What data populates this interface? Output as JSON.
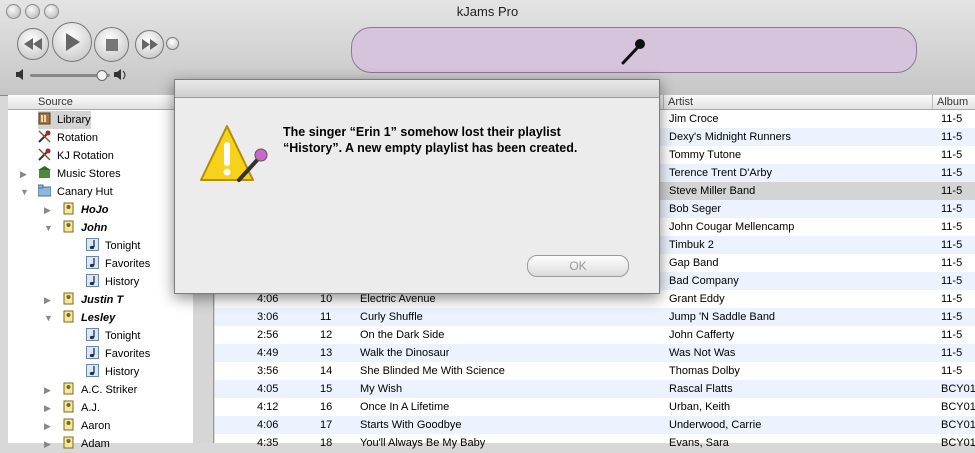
{
  "window": {
    "title": "kJams Pro"
  },
  "transport": {
    "rewind_icon": "rewind-icon",
    "play_icon": "play-icon",
    "stop_icon": "stop-icon",
    "forward_icon": "fast-forward-icon"
  },
  "source": {
    "header": "Source",
    "items": [
      {
        "label": "Library",
        "icon": "library-icon",
        "indent": 0,
        "bold": false,
        "italic": false,
        "disclosure": "",
        "selected": true
      },
      {
        "label": "Rotation",
        "icon": "mic-rotation-icon",
        "indent": 0,
        "bold": false,
        "italic": false,
        "disclosure": ""
      },
      {
        "label": "KJ Rotation",
        "icon": "mic-rotation-icon",
        "indent": 0,
        "bold": false,
        "italic": false,
        "disclosure": ""
      },
      {
        "label": "Music Stores",
        "icon": "store-icon",
        "indent": 0,
        "bold": false,
        "italic": false,
        "disclosure": "closed"
      },
      {
        "label": "Canary Hut",
        "icon": "folder-icon",
        "indent": 0,
        "bold": false,
        "italic": false,
        "disclosure": "open"
      },
      {
        "label": "HoJo",
        "icon": "singer-icon",
        "indent": 1,
        "bold": true,
        "italic": true,
        "disclosure": "closed"
      },
      {
        "label": "John",
        "icon": "singer-icon",
        "indent": 1,
        "bold": true,
        "italic": true,
        "disclosure": "open"
      },
      {
        "label": "Tonight",
        "icon": "playlist-icon",
        "indent": 2,
        "bold": false,
        "italic": false,
        "disclosure": ""
      },
      {
        "label": "Favorites",
        "icon": "playlist-icon",
        "indent": 2,
        "bold": false,
        "italic": false,
        "disclosure": ""
      },
      {
        "label": "History",
        "icon": "playlist-icon",
        "indent": 2,
        "bold": false,
        "italic": false,
        "disclosure": ""
      },
      {
        "label": "Justin T",
        "icon": "singer-icon",
        "indent": 1,
        "bold": true,
        "italic": true,
        "disclosure": "closed"
      },
      {
        "label": "Lesley",
        "icon": "singer-icon",
        "indent": 1,
        "bold": true,
        "italic": true,
        "disclosure": "open"
      },
      {
        "label": "Tonight",
        "icon": "playlist-icon",
        "indent": 2,
        "bold": false,
        "italic": false,
        "disclosure": ""
      },
      {
        "label": "Favorites",
        "icon": "playlist-icon",
        "indent": 2,
        "bold": false,
        "italic": false,
        "disclosure": ""
      },
      {
        "label": "History",
        "icon": "playlist-icon",
        "indent": 2,
        "bold": false,
        "italic": false,
        "disclosure": ""
      },
      {
        "label": "A.C. Striker",
        "icon": "singer-icon",
        "indent": 1,
        "bold": false,
        "italic": false,
        "disclosure": "closed"
      },
      {
        "label": "A.J.",
        "icon": "singer-icon",
        "indent": 1,
        "bold": false,
        "italic": false,
        "disclosure": "closed"
      },
      {
        "label": "Aaron",
        "icon": "singer-icon",
        "indent": 1,
        "bold": false,
        "italic": false,
        "disclosure": "closed"
      },
      {
        "label": "Adam",
        "icon": "singer-icon",
        "indent": 1,
        "bold": false,
        "italic": false,
        "disclosure": "closed"
      }
    ]
  },
  "table": {
    "columns": {
      "artist": "Artist",
      "album": "Album"
    },
    "rows": [
      {
        "time": "",
        "track": "",
        "name": "",
        "artist": "Jim Croce",
        "album": "11-5"
      },
      {
        "time": "",
        "track": "",
        "name": "",
        "artist": "Dexy's Midnight Runners",
        "album": "11-5"
      },
      {
        "time": "",
        "track": "",
        "name": "",
        "artist": "Tommy Tutone",
        "album": "11-5"
      },
      {
        "time": "",
        "track": "",
        "name": "",
        "artist": "Terence Trent D'Arby",
        "album": "11-5"
      },
      {
        "time": "",
        "track": "",
        "name": "",
        "artist": "Steve Miller Band",
        "album": "11-5",
        "selected": true
      },
      {
        "time": "",
        "track": "",
        "name": "",
        "artist": "Bob Seger",
        "album": "11-5"
      },
      {
        "time": "",
        "track": "",
        "name": "",
        "artist": "John Cougar Mellencamp",
        "album": "11-5"
      },
      {
        "time": "",
        "track": "",
        "name": "",
        "artist": "Timbuk 2",
        "album": "11-5"
      },
      {
        "time": "",
        "track": "",
        "name": "",
        "artist": "Gap Band",
        "album": "11-5"
      },
      {
        "time": "",
        "track": "",
        "name": "",
        "artist": "Bad Company",
        "album": "11-5"
      },
      {
        "time": "4:06",
        "track": "10",
        "name": "Electric Avenue",
        "artist": "Grant Eddy",
        "album": "11-5"
      },
      {
        "time": "3:06",
        "track": "11",
        "name": "Curly Shuffle",
        "artist": "Jump 'N Saddle Band",
        "album": "11-5"
      },
      {
        "time": "2:56",
        "track": "12",
        "name": "On the Dark Side",
        "artist": "John Cafferty",
        "album": "11-5"
      },
      {
        "time": "4:49",
        "track": "13",
        "name": "Walk the Dinosaur",
        "artist": "Was Not Was",
        "album": "11-5"
      },
      {
        "time": "3:56",
        "track": "14",
        "name": "She Blinded Me With Science",
        "artist": "Thomas Dolby",
        "album": "11-5"
      },
      {
        "time": "4:05",
        "track": "15",
        "name": "My Wish",
        "artist": "Rascal Flatts",
        "album": "BCY01"
      },
      {
        "time": "4:12",
        "track": "16",
        "name": "Once In A Lifetime",
        "artist": "Urban, Keith",
        "album": "BCY01"
      },
      {
        "time": "4:06",
        "track": "17",
        "name": "Starts With Goodbye",
        "artist": "Underwood, Carrie",
        "album": "BCY01"
      },
      {
        "time": "4:35",
        "track": "18",
        "name": "You'll Always Be My Baby",
        "artist": "Evans, Sara",
        "album": "BCY01"
      }
    ]
  },
  "dialog": {
    "line1": "The singer “Erin 1” somehow lost their playlist",
    "line2": "“History”.  A new empty playlist has been created.",
    "ok_label": "OK",
    "icon": "warning-icon"
  },
  "colors": {
    "lcd": "#d6c3dc",
    "row_alt": "#edf3fe",
    "row_selected": "#d4d4d4"
  }
}
